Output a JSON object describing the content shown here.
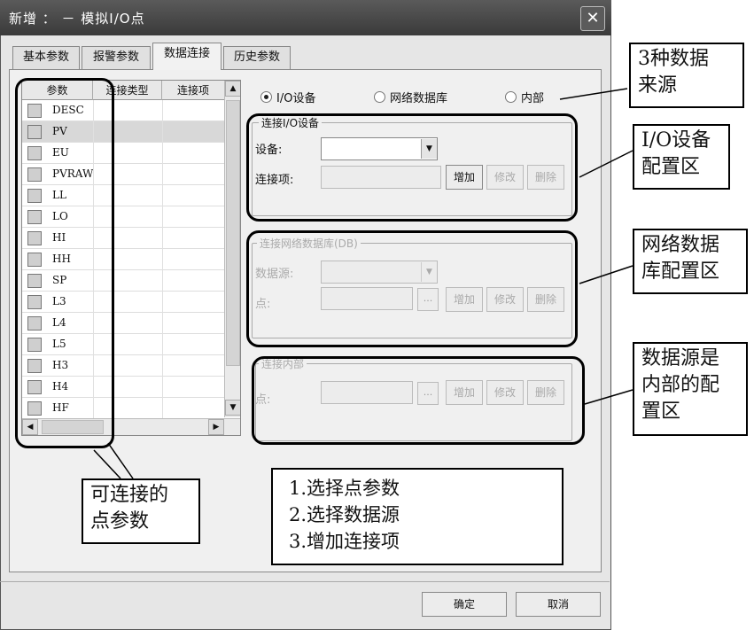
{
  "window": {
    "title": "新增 ： － 模拟I/O点",
    "close": "✕"
  },
  "tabs": [
    "基本参数",
    "报警参数",
    "数据连接",
    "历史参数"
  ],
  "table": {
    "headers": [
      "参数",
      "连接类型",
      "连接项"
    ],
    "rows": [
      "DESC",
      "PV",
      "EU",
      "PVRAW",
      "LL",
      "LO",
      "HI",
      "HH",
      "SP",
      "L3",
      "L4",
      "L5",
      "H3",
      "H4",
      "HF"
    ],
    "selected": "PV"
  },
  "radios": [
    "I/O设备",
    "网络数据库",
    "内部"
  ],
  "radio_selected": "I/O设备",
  "io_group": {
    "legend": "连接I/O设备",
    "device_label": "设备:",
    "item_label": "连接项:"
  },
  "db_group": {
    "legend": "连接网络数据库(DB)",
    "source_label": "数据源:",
    "point_label": "点:"
  },
  "internal_group": {
    "legend": "连接内部",
    "point_label": "点:"
  },
  "buttons": {
    "add": "增加",
    "modify": "修改",
    "delete": "删除",
    "browse": "...",
    "ok": "确定",
    "cancel": "取消"
  },
  "annotations": {
    "sources": [
      "3种数据",
      "来源"
    ],
    "io_area": [
      "I/O设备",
      "配置区"
    ],
    "db_area": [
      "网络数据",
      "库配置区"
    ],
    "internal_area": [
      "数据源是",
      "内部的配",
      "置区"
    ],
    "points": [
      "可连接的",
      "点参数"
    ],
    "steps": [
      "1.选择点参数",
      "2.选择数据源",
      "3.增加连接项"
    ]
  }
}
